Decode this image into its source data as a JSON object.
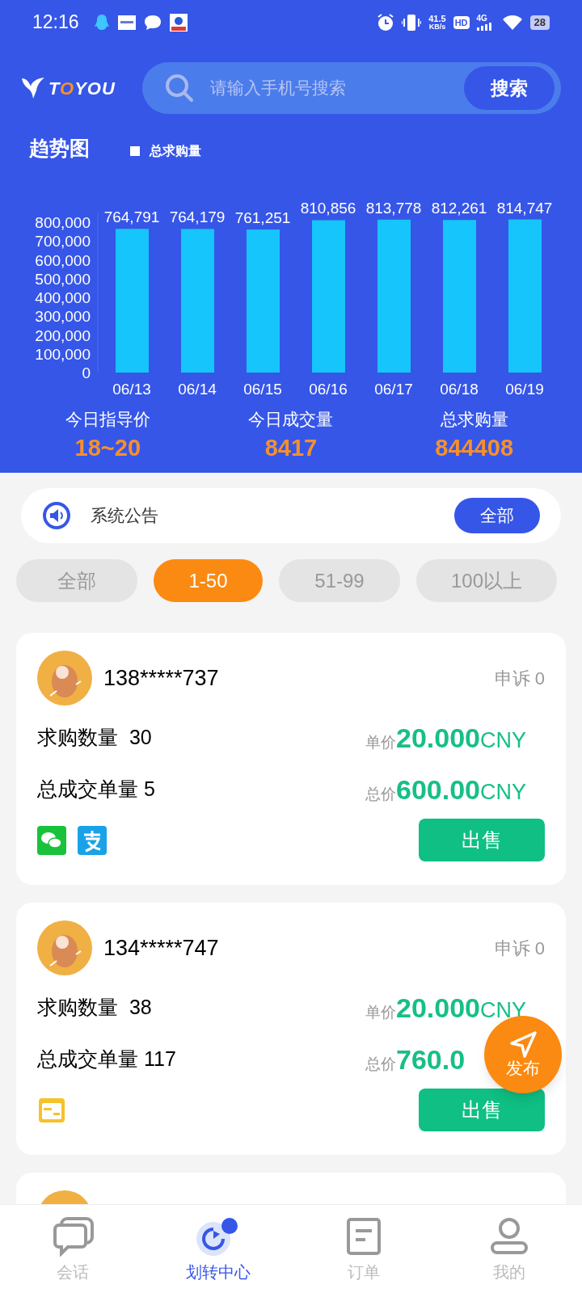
{
  "status_bar": {
    "time": "12:16",
    "speed": "41.5",
    "speed_unit": "KB/s",
    "hd": "HD",
    "network": "4G",
    "battery": "28"
  },
  "header": {
    "logo": "TOYOU",
    "search": {
      "placeholder": "请输入手机号搜索"
    },
    "search_button": "搜索"
  },
  "trend": {
    "title": "趋势图",
    "chart_data": {
      "type": "bar",
      "ylim": [
        0,
        850000
      ],
      "categories": [
        "06/13",
        "06/14",
        "06/15",
        "06/16",
        "06/17",
        "06/18",
        "06/19"
      ],
      "series": [
        {
          "name": "总求购量",
          "color": "#16c5fb",
          "values": [
            764791,
            764179,
            761251,
            810856,
            813778,
            812261,
            814747
          ]
        }
      ],
      "yticks": [
        {
          "value": 0,
          "label": "0"
        },
        {
          "value": 100000,
          "label": "100,000"
        },
        {
          "value": 200000,
          "label": "200,000"
        },
        {
          "value": 300000,
          "label": "300,000"
        },
        {
          "value": 400000,
          "label": "400,000"
        },
        {
          "value": 500000,
          "label": "500,000"
        },
        {
          "value": 600000,
          "label": "600,000"
        },
        {
          "value": 700000,
          "label": "700,000"
        },
        {
          "value": 800000,
          "label": "800,000"
        }
      ],
      "value_labels": [
        "764,791",
        "764,179",
        "761,251",
        "810,856",
        "813,778",
        "812,261",
        "814,747"
      ]
    }
  },
  "stats": [
    {
      "label": "今日指导价",
      "value": "18~20"
    },
    {
      "label": "今日成交量",
      "value": "8417"
    },
    {
      "label": "总求购量",
      "value": "844408"
    }
  ],
  "notice": {
    "text": "系统公告",
    "button": "全部"
  },
  "filters": [
    {
      "label": "全部",
      "selected": false
    },
    {
      "label": "1-50",
      "selected": true
    },
    {
      "label": "51-99",
      "selected": false
    },
    {
      "label": "100以上",
      "selected": false
    }
  ],
  "orders": [
    {
      "phone": "138*****737",
      "appeal": "申诉 0",
      "quantity": "求购数量  30",
      "unit_label": "单价",
      "unit_price": "20.000",
      "unit_currency": "CNY",
      "deals": "总成交单量 5",
      "total_label": "总价",
      "total_price": "600.00",
      "total_currency": "CNY",
      "payments": [
        {
          "kind": "wechat"
        },
        {
          "kind": "alipay"
        }
      ],
      "button": "出售"
    },
    {
      "phone": "134*****747",
      "appeal": "申诉 0",
      "quantity": "求购数量  38",
      "unit_label": "单价",
      "unit_price": "20.000",
      "unit_currency": "CNY",
      "deals": "总成交单量 117",
      "total_label": "总价",
      "total_price": "760.0",
      "payments": [
        {
          "kind": "card"
        }
      ],
      "button": "出售"
    }
  ],
  "publish_button": "发布",
  "nav": [
    {
      "label": "会话",
      "kind": "chat",
      "selected": false
    },
    {
      "label": "划转中心",
      "kind": "transfer",
      "selected": true
    },
    {
      "label": "订单",
      "kind": "orders",
      "selected": false
    },
    {
      "label": "我的",
      "kind": "profile",
      "selected": false
    }
  ]
}
